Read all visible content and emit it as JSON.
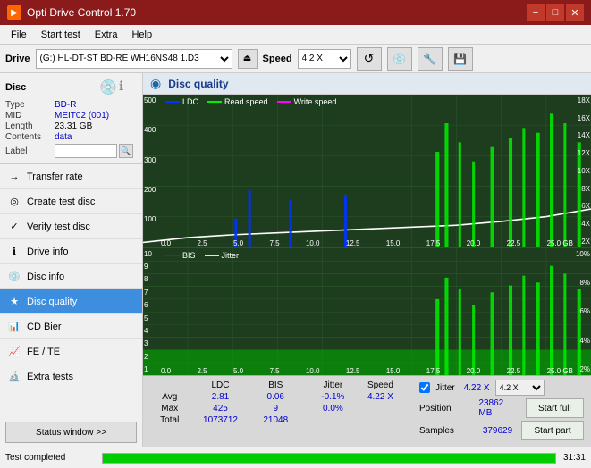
{
  "titlebar": {
    "title": "Opti Drive Control 1.70",
    "icon": "ODC",
    "min": "−",
    "max": "□",
    "close": "✕"
  },
  "menubar": {
    "items": [
      "File",
      "Start test",
      "Extra",
      "Help"
    ]
  },
  "drivebar": {
    "label": "Drive",
    "drive_value": "(G:)  HL-DT-ST BD-RE  WH16NS48 1.D3",
    "speed_label": "Speed",
    "speed_value": "4.2 X"
  },
  "disc": {
    "header": "Disc",
    "type_label": "Type",
    "type_value": "BD-R",
    "mid_label": "MID",
    "mid_value": "MEIT02 (001)",
    "length_label": "Length",
    "length_value": "23.31 GB",
    "contents_label": "Contents",
    "contents_value": "data",
    "label_label": "Label",
    "label_value": ""
  },
  "nav": {
    "items": [
      {
        "id": "transfer-rate",
        "label": "Transfer rate",
        "icon": "→"
      },
      {
        "id": "create-test-disc",
        "label": "Create test disc",
        "icon": "◎"
      },
      {
        "id": "verify-test-disc",
        "label": "Verify test disc",
        "icon": "✓"
      },
      {
        "id": "drive-info",
        "label": "Drive info",
        "icon": "ℹ"
      },
      {
        "id": "disc-info",
        "label": "Disc info",
        "icon": "💿"
      },
      {
        "id": "disc-quality",
        "label": "Disc quality",
        "icon": "★",
        "active": true
      },
      {
        "id": "cd-bier",
        "label": "CD Bier",
        "icon": "📊"
      },
      {
        "id": "fe-te",
        "label": "FE / TE",
        "icon": "📈"
      },
      {
        "id": "extra-tests",
        "label": "Extra tests",
        "icon": "🔬"
      }
    ],
    "status_window": "Status window >>"
  },
  "chart": {
    "title": "Disc quality",
    "icon": "◉",
    "top_legend": [
      {
        "color": "#0000ff",
        "label": "LDC"
      },
      {
        "color": "#00cc00",
        "label": "Read speed"
      },
      {
        "color": "#ff00ff",
        "label": "Write speed"
      }
    ],
    "bottom_legend": [
      {
        "color": "#0000ff",
        "label": "BIS"
      },
      {
        "color": "#ffff00",
        "label": "Jitter"
      }
    ],
    "top_ymax": 500,
    "top_yright_max": 18,
    "bottom_ymax": 10,
    "bottom_yright_max": 10,
    "xmax": 25.0
  },
  "stats": {
    "headers": [
      "",
      "LDC",
      "BIS",
      "",
      "Jitter",
      "Speed",
      ""
    ],
    "avg_label": "Avg",
    "avg_ldc": "2.81",
    "avg_bis": "0.06",
    "avg_jitter": "-0.1%",
    "avg_speed": "4.22 X",
    "max_label": "Max",
    "max_ldc": "425",
    "max_bis": "9",
    "max_jitter": "0.0%",
    "max_speed_label": "Position",
    "max_speed_val": "23862 MB",
    "total_label": "Total",
    "total_ldc": "1073712",
    "total_bis": "21048",
    "total_jitter": "",
    "samples_label": "Samples",
    "samples_val": "379629",
    "jitter_check": "Jitter",
    "speed_select": "4.2 X",
    "start_full": "Start full",
    "start_part": "Start part"
  },
  "statusbar": {
    "status_text": "Test completed",
    "progress": 100,
    "time": "31:31"
  }
}
